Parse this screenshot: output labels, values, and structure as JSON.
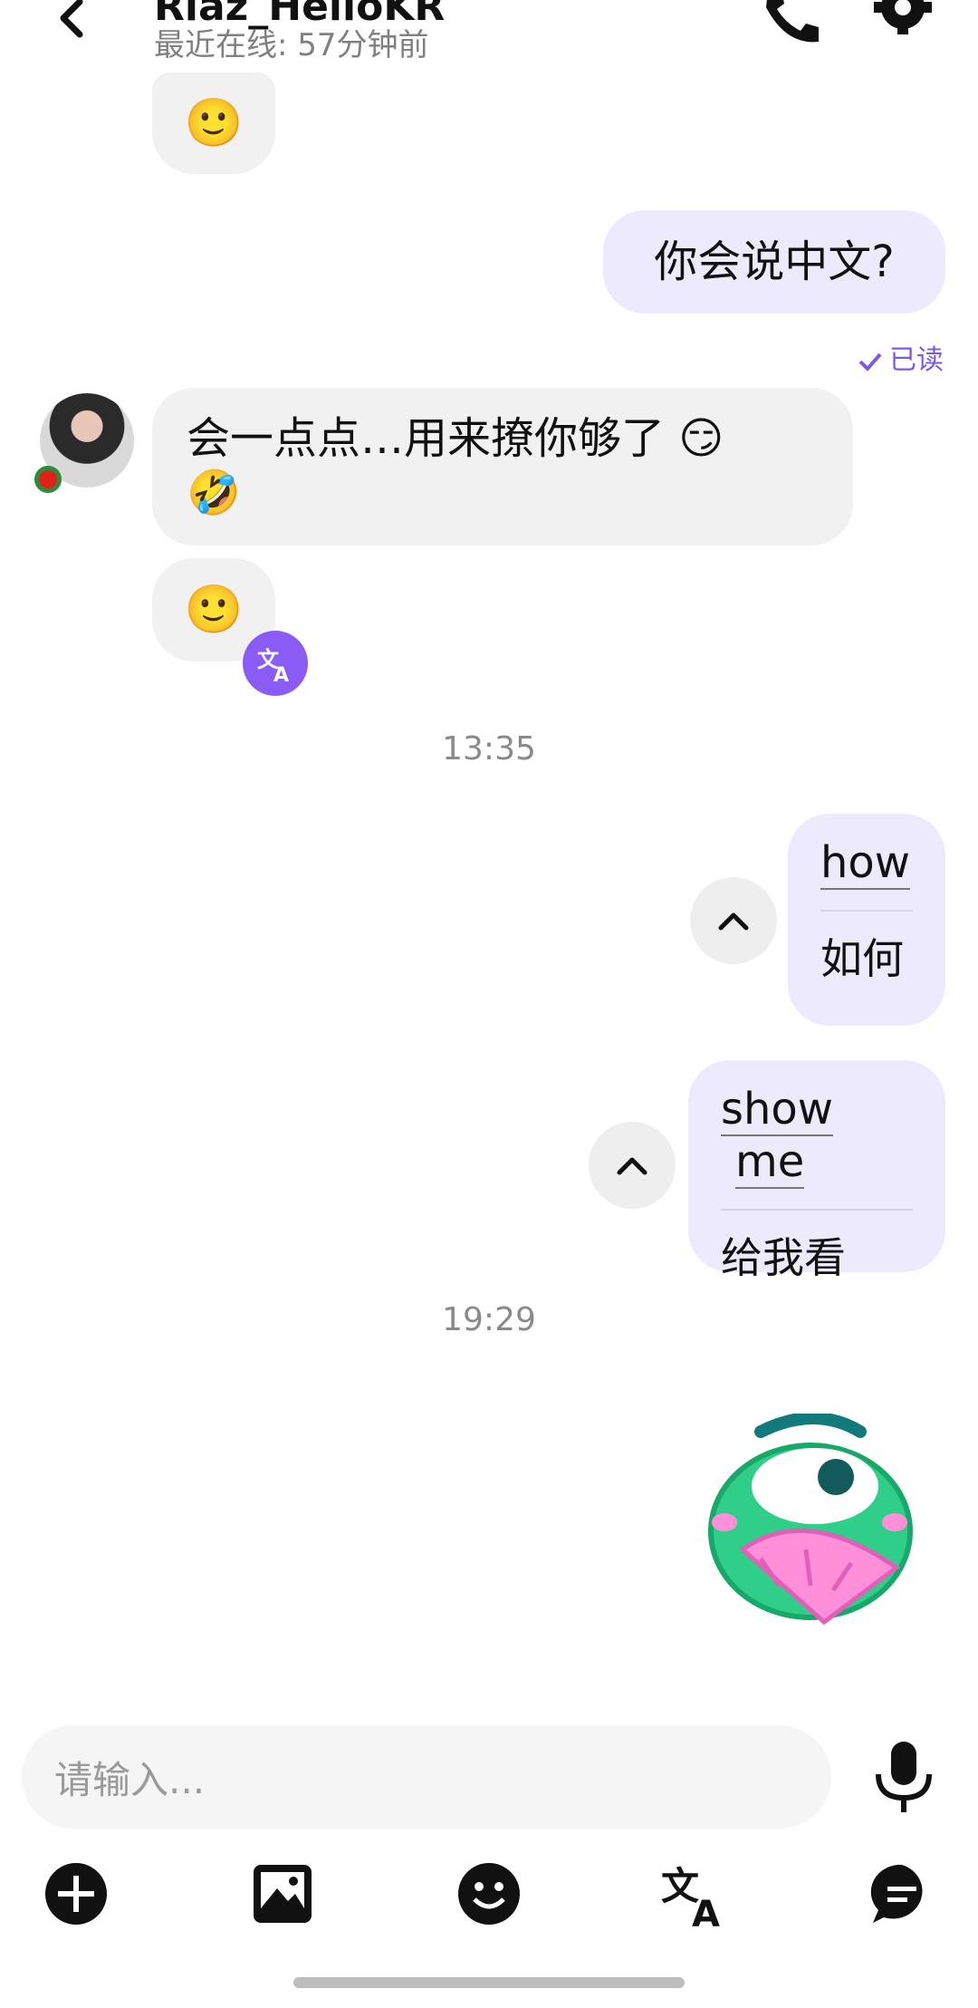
{
  "header": {
    "title": "Riaz_HelloKR",
    "status": "最近在线: 57分钟前"
  },
  "messages": {
    "m1_emoji": "🙂",
    "m2_text": "你会说中文?",
    "read_receipt": "已读",
    "m3_line1": "会一点点…用来撩你够了 😏",
    "m3_line2": "🤣",
    "m4_emoji": "🙂",
    "time1": "13:35",
    "m5_word": "how",
    "m5_translation": "如何",
    "m6_word1": "show",
    "m6_word2": "me",
    "m6_translation": "给我看",
    "time2": "19:29"
  },
  "composer": {
    "placeholder": "请输入..."
  },
  "colors": {
    "accent": "#8a5cf5",
    "outgoing_bubble": "#eeeafd",
    "incoming_bubble": "#f1f1f1"
  },
  "icons": [
    "back-icon",
    "phone-icon",
    "gear-icon",
    "translate-icon",
    "chevron-up-icon",
    "microphone-icon",
    "add-icon",
    "image-icon",
    "emoji-icon",
    "translate-tool-icon",
    "chat-icon"
  ]
}
